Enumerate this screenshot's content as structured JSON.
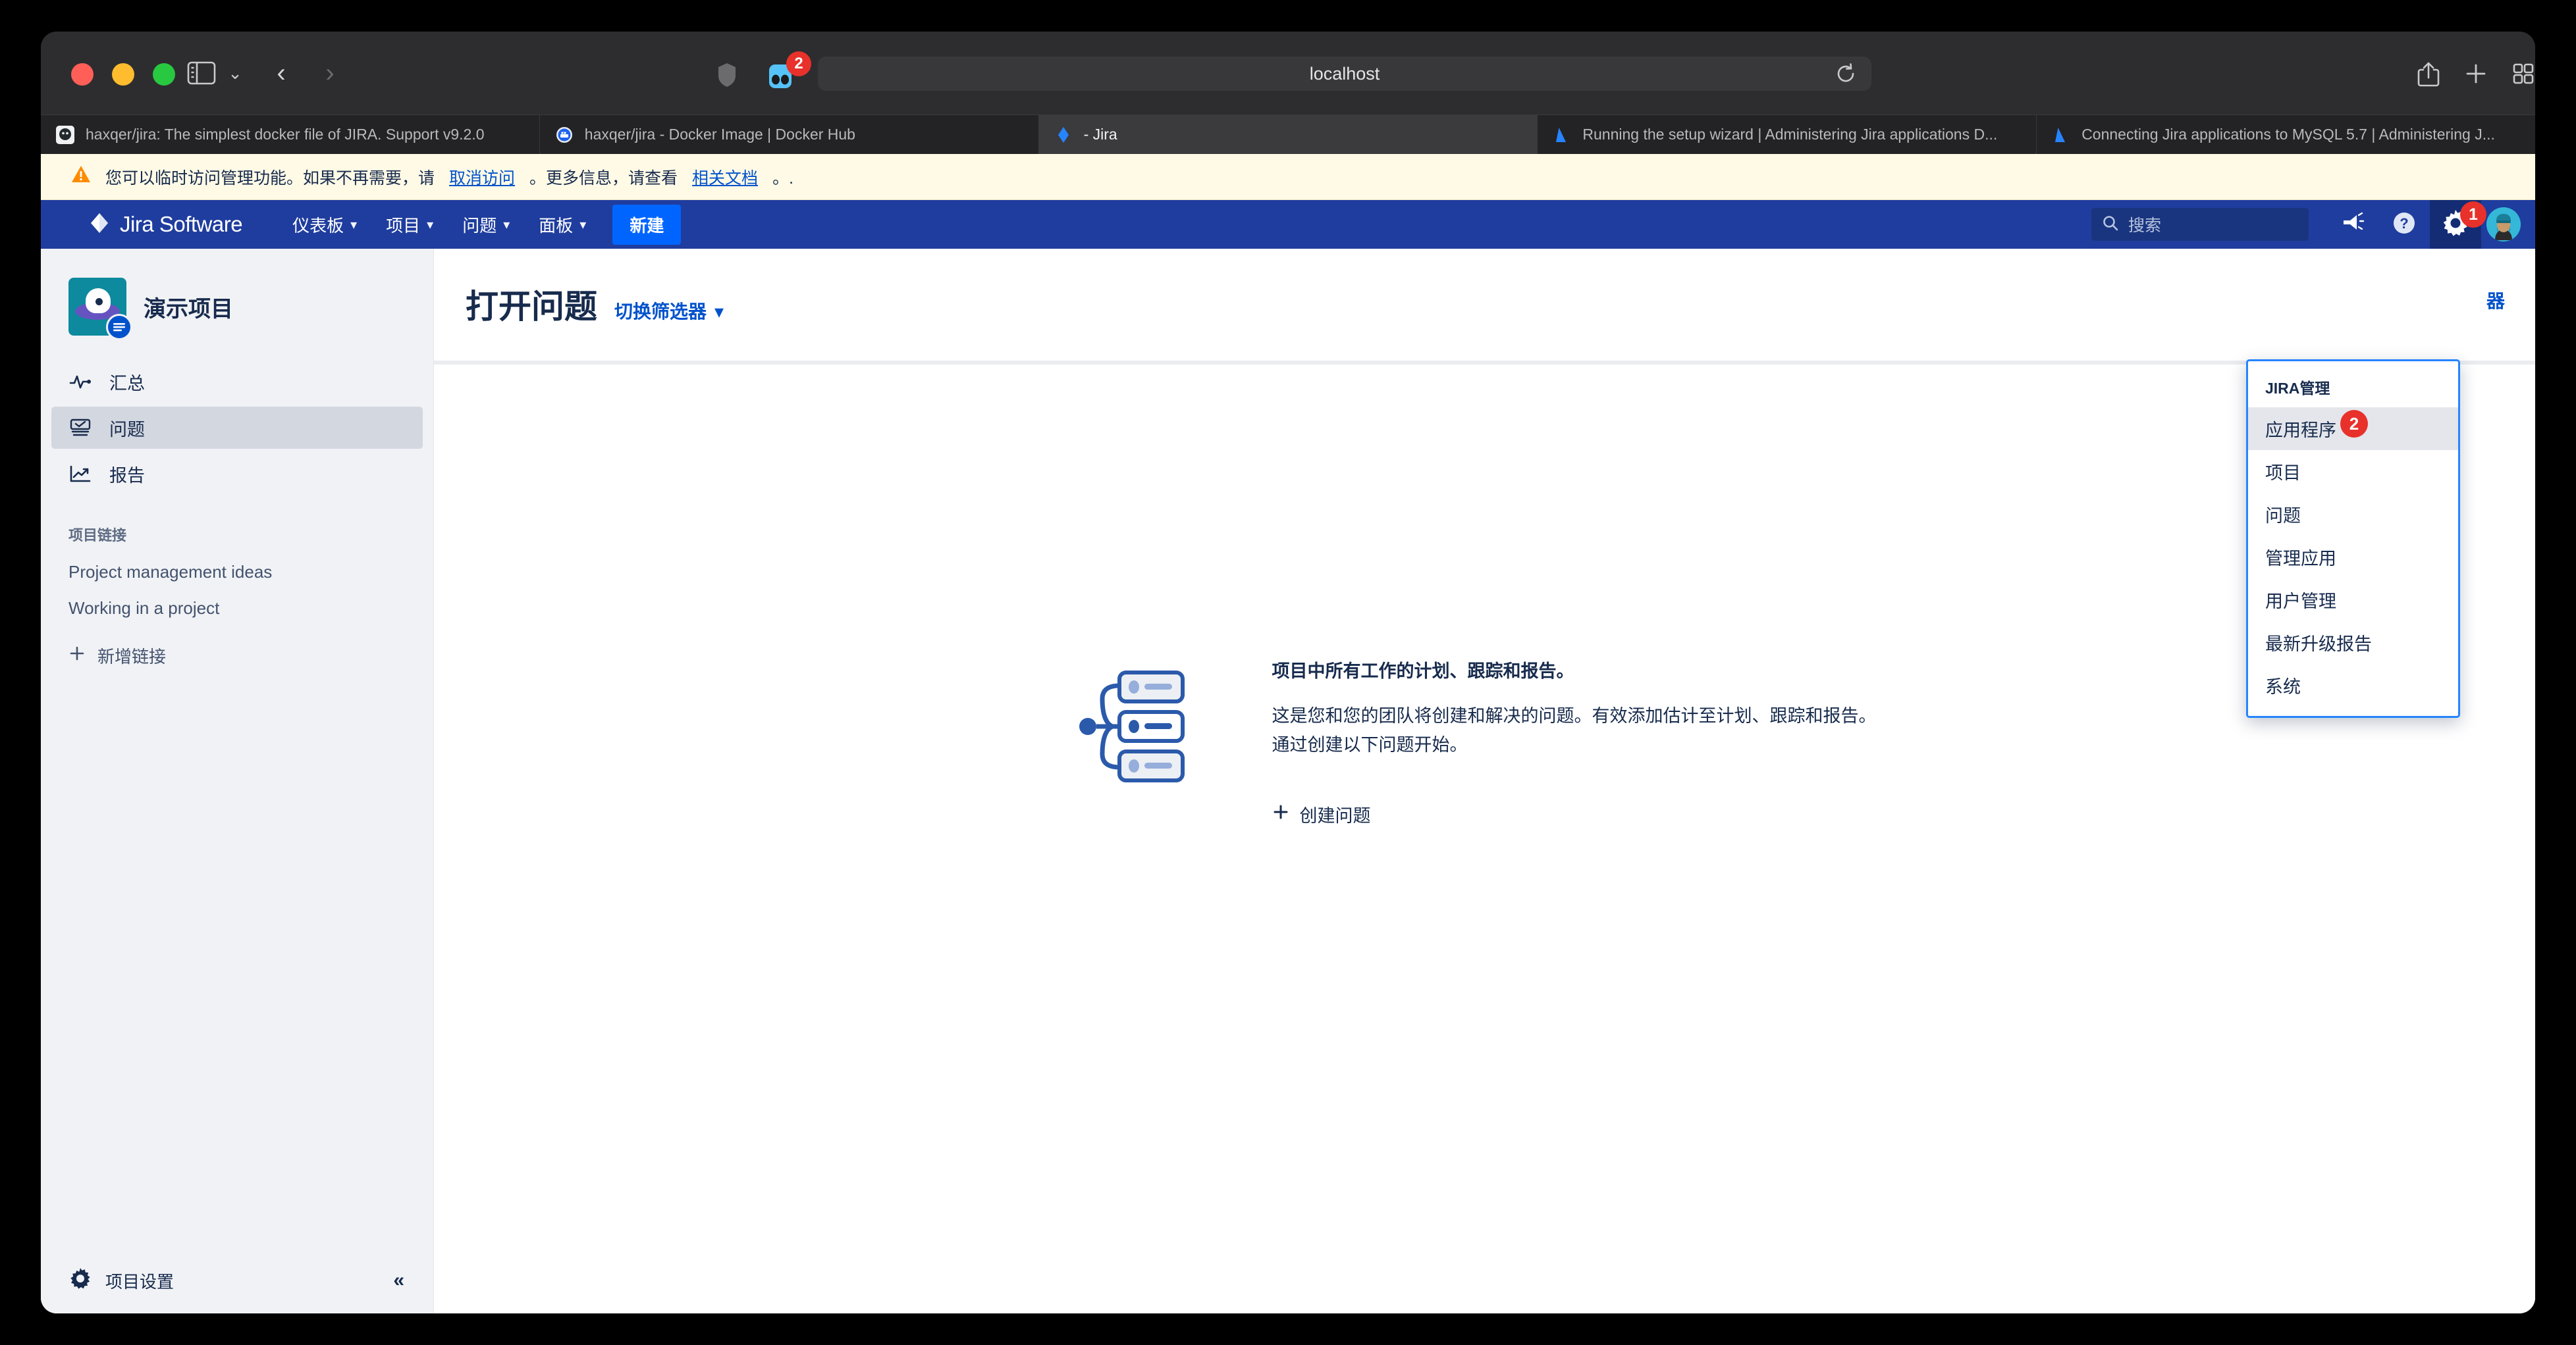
{
  "browser": {
    "url": "localhost",
    "extension_badge": "2",
    "icons": {
      "sidebar_toggle": "sidebar-toggle-icon",
      "chevron_down": "chevron-down-icon",
      "back": "back-arrow-icon",
      "forward": "forward-arrow-icon",
      "shield": "shield-icon",
      "extension": "extension-icon",
      "reload": "reload-icon",
      "share": "share-icon",
      "new_tab": "plus-icon",
      "tab_overview": "tab-grid-icon"
    },
    "tabs": [
      {
        "title": "haxqer/jira: The simplest docker file of JIRA. Support v9.2.0",
        "favicon": "github-icon",
        "active": false
      },
      {
        "title": "haxqer/jira - Docker Image | Docker Hub",
        "favicon": "docker-icon",
        "active": false
      },
      {
        "title": "- Jira",
        "favicon": "jira-icon",
        "active": true
      },
      {
        "title": "Running the setup wizard | Administering Jira applications D...",
        "favicon": "atlassian-icon",
        "active": false
      },
      {
        "title": "Connecting Jira applications to MySQL 5.7 | Administering J...",
        "favicon": "atlassian-icon",
        "active": false
      }
    ]
  },
  "warning": {
    "icon": "warning-icon",
    "text_before": "您可以临时访问管理功能。如果不再需要，请",
    "link1": "取消访问",
    "text_middle": "。更多信息，请查看",
    "link2": "相关文档",
    "text_after": "。."
  },
  "topnav": {
    "logo_text": "Jira Software",
    "logo_icon": "jira-logo-icon",
    "items": [
      {
        "label": "仪表板",
        "caret": "▾"
      },
      {
        "label": "项目",
        "caret": "▾"
      },
      {
        "label": "问题",
        "caret": "▾"
      },
      {
        "label": "面板",
        "caret": "▾"
      }
    ],
    "create_button": "新建",
    "search_placeholder": "搜索",
    "search_icon": "search-icon",
    "announce_icon": "megaphone-icon",
    "help_icon": "help-icon",
    "settings_icon": "gear-icon",
    "settings_badge": "1",
    "avatar_icon": "user-avatar"
  },
  "admin_dropdown": {
    "title": "JIRA管理",
    "badge": "2",
    "items": [
      {
        "label": "应用程序",
        "highlight": true
      },
      {
        "label": "项目",
        "highlight": false
      },
      {
        "label": "问题",
        "highlight": false
      },
      {
        "label": "管理应用",
        "highlight": false
      },
      {
        "label": "用户管理",
        "highlight": false
      },
      {
        "label": "最新升级报告",
        "highlight": false
      },
      {
        "label": "系统",
        "highlight": false
      }
    ]
  },
  "sidebar": {
    "project_name": "演示项目",
    "project_avatar_icon": "project-avatar-icon",
    "project_badge_icon": "software-project-badge-icon",
    "nav": [
      {
        "label": "汇总",
        "icon": "pulse-icon",
        "selected": false
      },
      {
        "label": "问题",
        "icon": "issues-icon",
        "selected": true
      },
      {
        "label": "报告",
        "icon": "reports-icon",
        "selected": false
      }
    ],
    "section_title": "项目链接",
    "links": [
      "Project management ideas",
      "Working in a project"
    ],
    "add_link": "新增链接",
    "add_link_icon": "plus-icon",
    "settings_label": "项目设置",
    "settings_icon": "gear-icon",
    "collapse_icon": "double-chevron-left-icon"
  },
  "main": {
    "title": "打开问题",
    "filter_switch": "切换筛选器",
    "filter_caret": "▾",
    "header_right_partial": "器",
    "empty": {
      "illustration": "issues-tree-illustration",
      "title": "项目中所有工作的计划、跟踪和报告。",
      "description": "这是您和您的团队将创建和解决的问题。有效添加估计至计划、跟踪和报告。通过创建以下问题开始。",
      "create_label": "创建问题",
      "create_icon": "plus-icon"
    }
  },
  "colors": {
    "jira_nav": "#1f3d9e",
    "accent_blue": "#0052cc",
    "create_button": "#0065ff",
    "badge_red": "#e8312b",
    "sidebar_bg": "#f1f2f5",
    "warning_bg": "#fffae6",
    "dropdown_border": "#2684ff"
  }
}
